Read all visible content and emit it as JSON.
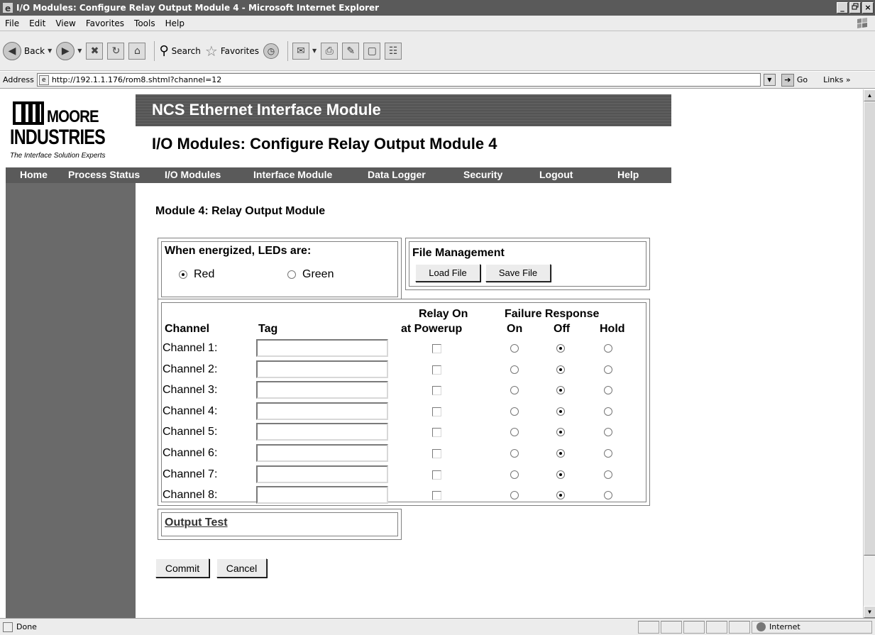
{
  "window": {
    "title": "I/O Modules: Configure Relay Output Module 4 - Microsoft Internet Explorer",
    "controls": [
      "_",
      "ő",
      "×"
    ]
  },
  "menu": [
    "File",
    "Edit",
    "View",
    "Favorites",
    "Tools",
    "Help"
  ],
  "toolbar": {
    "back_label": "Back",
    "search_label": "Search",
    "favorites_label": "Favorites"
  },
  "address": {
    "label": "Address",
    "url": "http://192.1.1.176/rom8.shtml?channel=12",
    "go_label": "Go",
    "links_label": "Links"
  },
  "logo": {
    "moore": "MOORE",
    "industries": "INDUSTRIES",
    "tagline": "The Interface Solution Experts"
  },
  "header": {
    "title": "NCS Ethernet Interface Module",
    "page_title": "I/O Modules: Configure Relay Output Module 4"
  },
  "nav": [
    "Home",
    "Process Status",
    "I/O Modules",
    "Interface Module",
    "Data Logger",
    "Security",
    "Logout",
    "Help"
  ],
  "module_heading": "Module 4: Relay Output Module",
  "leds": {
    "title": "When energized, LEDs are:",
    "options": [
      "Red",
      "Green"
    ],
    "selected": "Red"
  },
  "file_management": {
    "title": "File Management",
    "load_label": "Load File",
    "save_label": "Save File"
  },
  "table": {
    "headers": {
      "channel": "Channel",
      "tag": "Tag",
      "relay_line1": "Relay On",
      "relay_line2": "at Powerup",
      "failure": "Failure Response",
      "on": "On",
      "off": "Off",
      "hold": "Hold"
    },
    "rows": [
      {
        "label": "Channel 1:",
        "tag": "",
        "relay_on": false,
        "failure": "Off"
      },
      {
        "label": "Channel 2:",
        "tag": "",
        "relay_on": false,
        "failure": "Off"
      },
      {
        "label": "Channel 3:",
        "tag": "",
        "relay_on": false,
        "failure": "Off"
      },
      {
        "label": "Channel 4:",
        "tag": "",
        "relay_on": false,
        "failure": "Off"
      },
      {
        "label": "Channel 5:",
        "tag": "",
        "relay_on": false,
        "failure": "Off"
      },
      {
        "label": "Channel 6:",
        "tag": "",
        "relay_on": false,
        "failure": "Off"
      },
      {
        "label": "Channel 7:",
        "tag": "",
        "relay_on": false,
        "failure": "Off"
      },
      {
        "label": "Channel 8:",
        "tag": "",
        "relay_on": false,
        "failure": "Off"
      }
    ]
  },
  "output_test": "Output Test",
  "actions": {
    "commit_label": "Commit",
    "cancel_label": "Cancel"
  },
  "status": {
    "text": "Done",
    "zone": "Internet"
  }
}
